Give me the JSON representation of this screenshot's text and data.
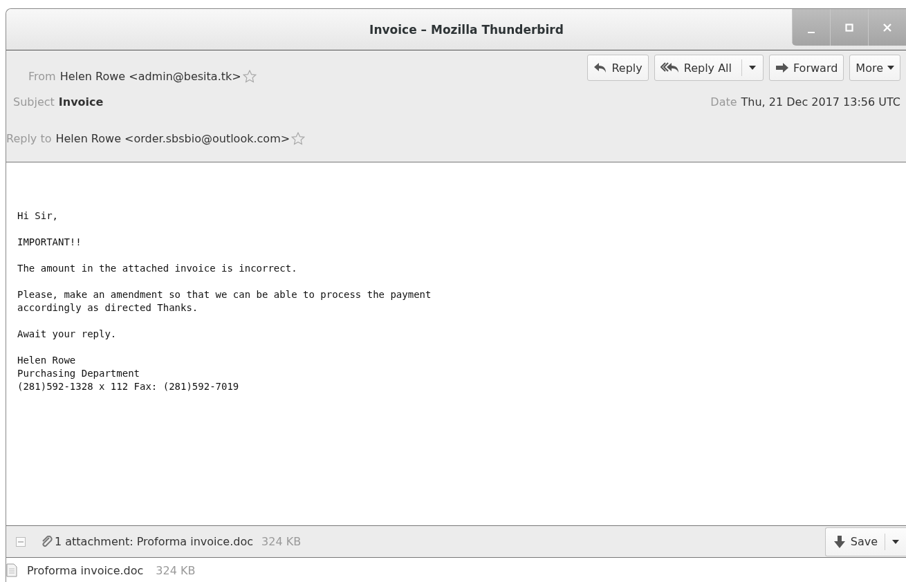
{
  "window": {
    "title": "Invoice – Mozilla Thunderbird"
  },
  "toolbar": [
    {
      "label": "Reply",
      "kind": "reply"
    },
    {
      "label": "Reply All",
      "kind": "reply_all"
    },
    {
      "label": "Forward",
      "kind": "forward"
    },
    {
      "label": "More",
      "kind": "menu"
    }
  ],
  "headers": {
    "from": {
      "label": "From",
      "value": "Helen Rowe <admin@besita.tk>",
      "starred": false
    },
    "subject": {
      "label": "Subject",
      "value": "Invoice"
    },
    "date": {
      "label": "Date",
      "value": "Thu, 21 Dec 2017 13:56 UTC"
    },
    "reply_to": {
      "label": "Reply to",
      "value": "Helen Rowe <order.sbsbio@outlook.com>",
      "starred": false
    }
  },
  "body": [
    [
      "Hi Sir,"
    ],
    [
      "IMPORTANT!!"
    ],
    [
      "The amount in the attached invoice is incorrect."
    ],
    [
      "Please, make an amendment so that we can be able to process the payment",
      "accordingly as directed Thanks."
    ],
    [
      "Await your reply."
    ],
    [
      "Helen Rowe",
      "Purchasing Department",
      "(281)592-1328 x 112 Fax: (281)592-7019"
    ]
  ],
  "attachment_bar": {
    "expanded": true,
    "summary": "1 attachment: Proforma invoice.doc",
    "size": "324 KB",
    "save_label": "Save"
  },
  "attachments": [
    {
      "name": "Proforma invoice.doc",
      "size": "324 KB"
    }
  ]
}
